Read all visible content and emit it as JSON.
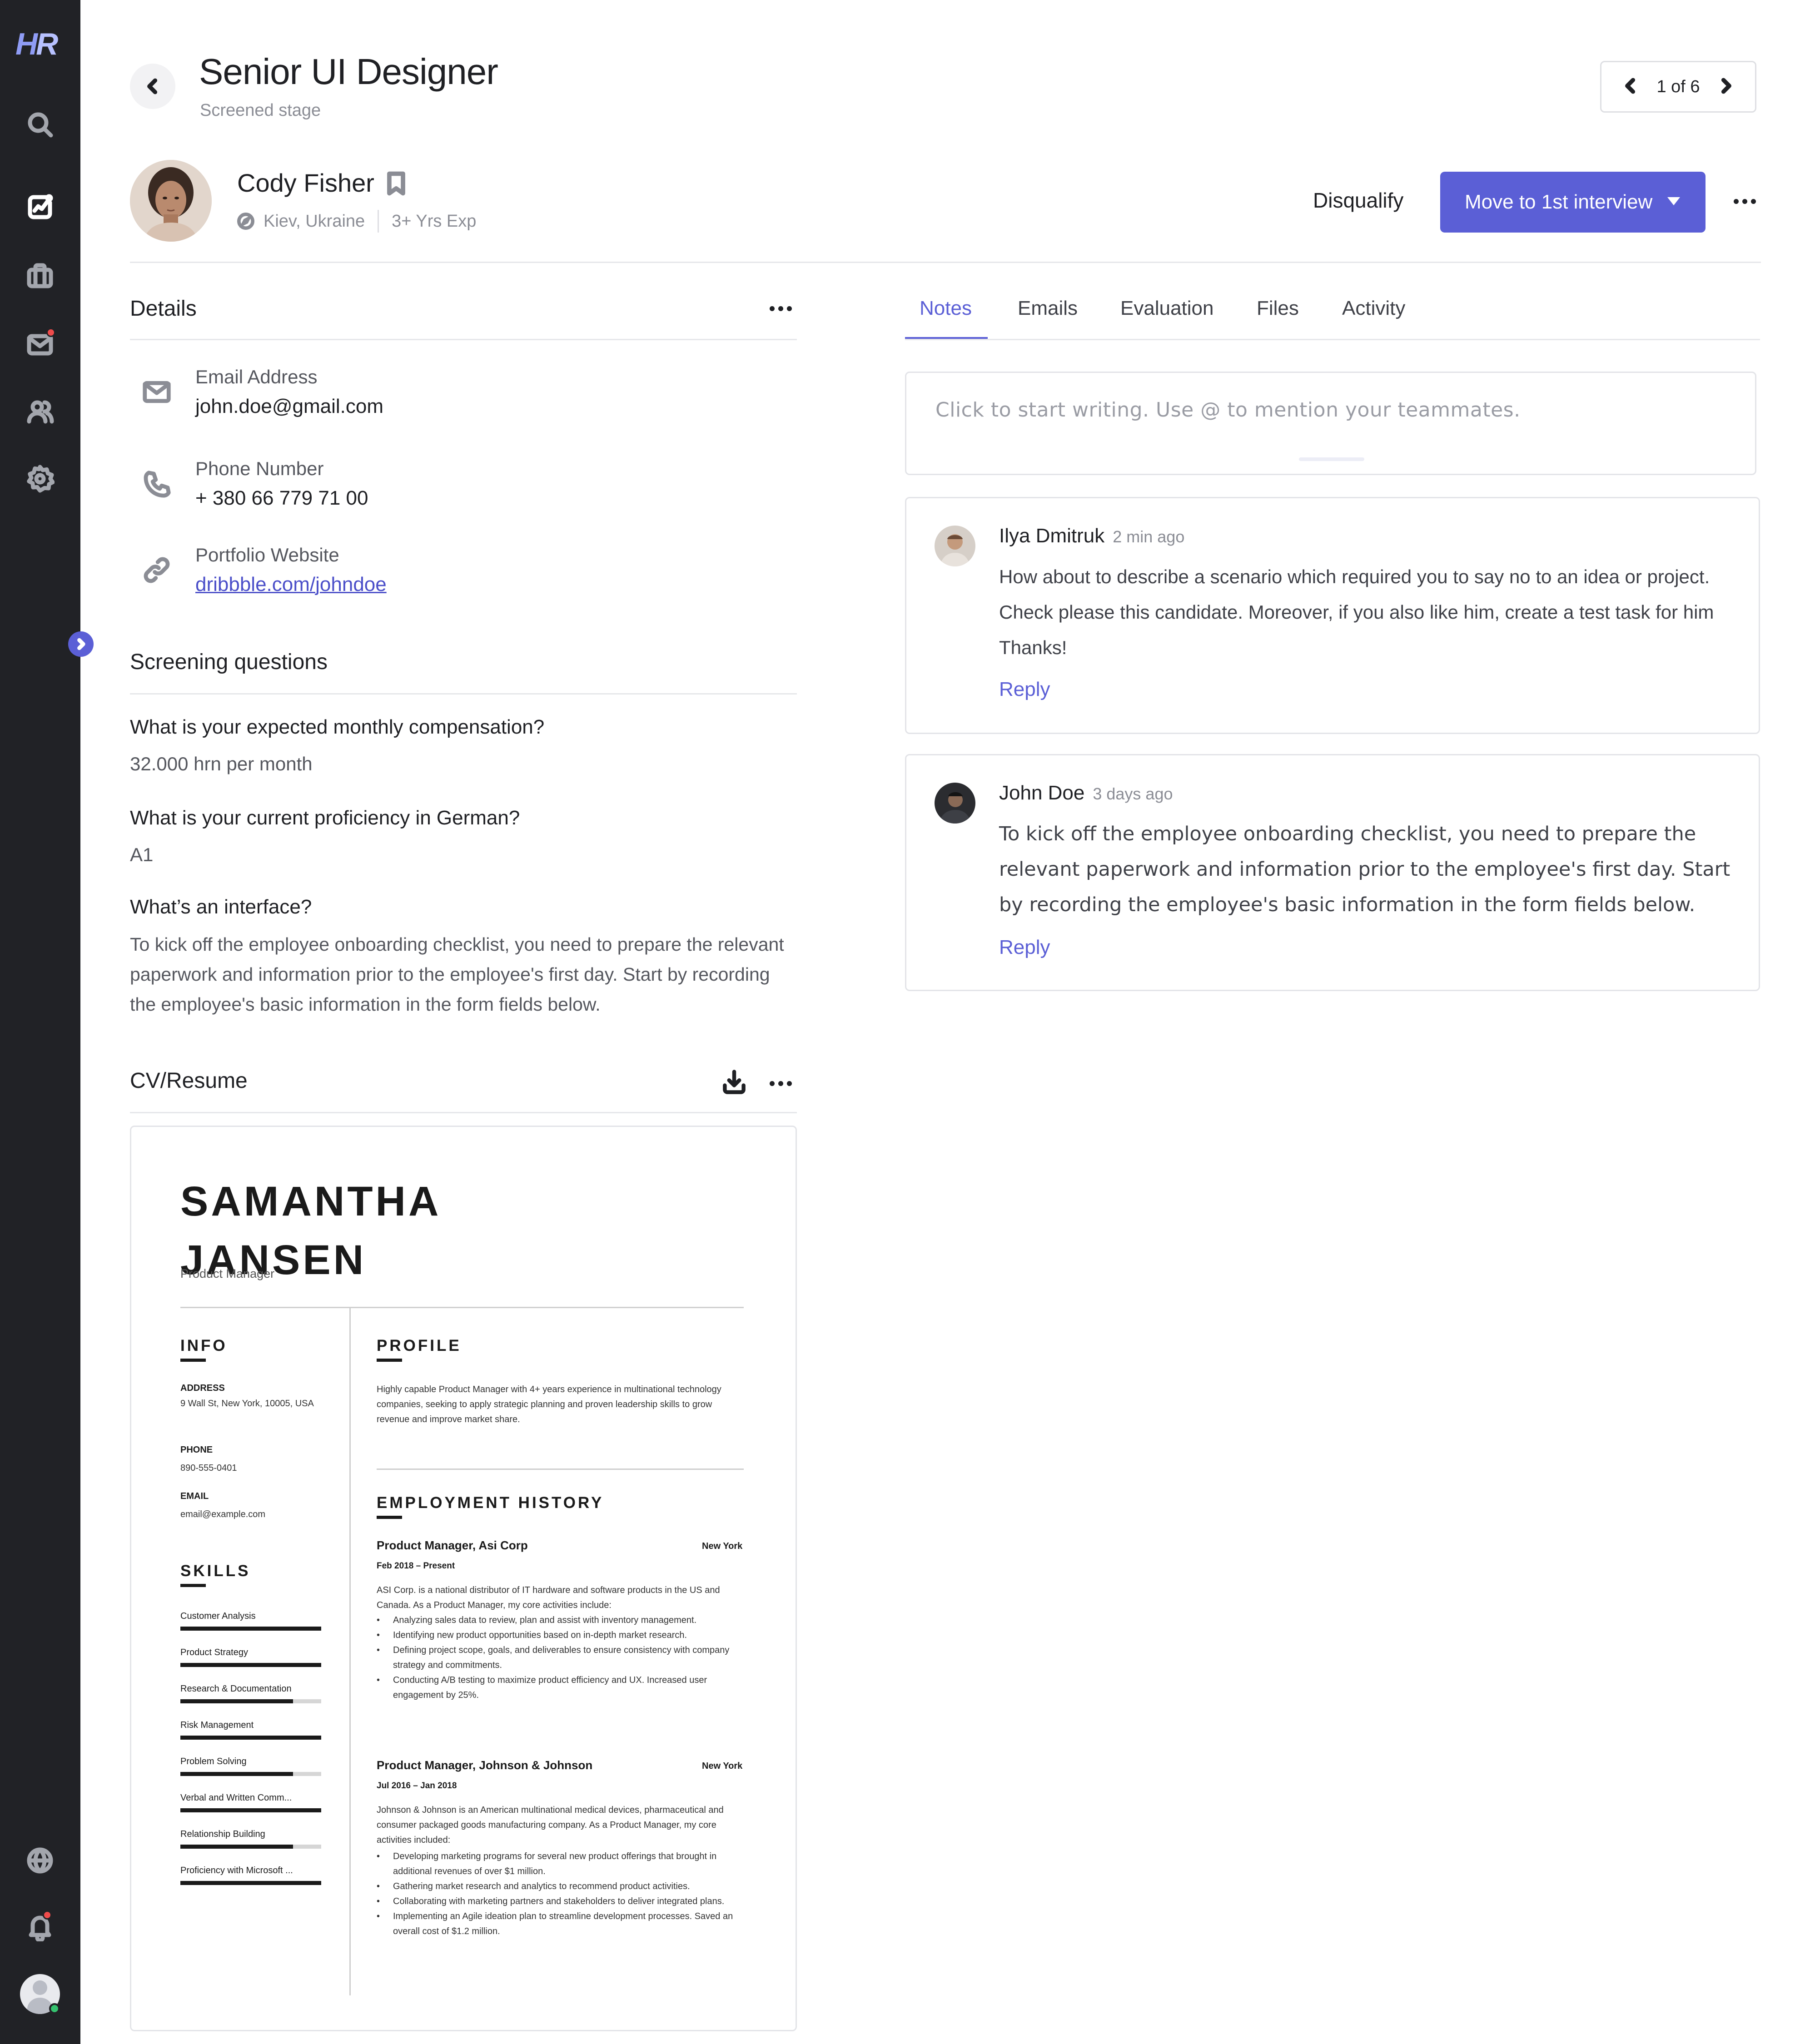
{
  "sidebar": {
    "logo_h": "H",
    "logo_r": "R",
    "nav": [
      {
        "icon": "search-icon"
      },
      {
        "icon": "analytics-icon"
      },
      {
        "icon": "briefcase-icon"
      },
      {
        "icon": "mail-icon"
      },
      {
        "icon": "users-icon"
      },
      {
        "icon": "gear-icon"
      },
      {
        "icon": "globe-icon"
      },
      {
        "icon": "bell-icon"
      }
    ]
  },
  "header": {
    "title": "Senior UI Designer",
    "stage": "Screened stage",
    "pager": "1 of 6"
  },
  "candidate": {
    "name": "Cody Fisher",
    "location": "Kiev, Ukraine",
    "experience": "3+ Yrs Exp",
    "disqualify_label": "Disqualify",
    "move_label": "Move to 1st interview"
  },
  "details": {
    "title": "Details",
    "email_label": "Email Address",
    "email_value": "john.doe@gmail.com",
    "phone_label": "Phone Number",
    "phone_value": "+ 380 66 779 71 00",
    "portfolio_label": "Portfolio Website",
    "portfolio_value": "dribbble.com/johndoe"
  },
  "screening": {
    "title": "Screening questions",
    "q1": "What is your expected monthly compensation?",
    "a1": "32.000 hrn per month",
    "q2": "What is your current proficiency in German?",
    "a2": "A1",
    "q3": "What’s an interface?",
    "a3": "To kick off the employee onboarding checklist, you need to prepare the relevant paperwork and information prior to the employee's first day. Start by recording the employee's basic information in the form fields below."
  },
  "cv": {
    "title": "CV/Resume",
    "name_line1": "SAMANTHA",
    "name_line2": "JANSEN",
    "role": "Product Manager",
    "info_heading": "INFO",
    "address_label": "ADDRESS",
    "address_value": "9 Wall St, New York, 10005, USA",
    "phone_label": "PHONE",
    "phone_value": "890-555-0401",
    "email_label": "EMAIL",
    "email_value": "email@example.com",
    "skills_heading": "SKILLS",
    "skills": [
      {
        "name": "Customer Analysis",
        "level": 1.0
      },
      {
        "name": "Product Strategy",
        "level": 1.0
      },
      {
        "name": "Research & Documentation",
        "level": 0.8
      },
      {
        "name": "Risk Management",
        "level": 1.0
      },
      {
        "name": "Problem Solving",
        "level": 0.8
      },
      {
        "name": "Verbal and Written Comm...",
        "level": 1.0
      },
      {
        "name": "Relationship Building",
        "level": 0.8
      },
      {
        "name": "Proficiency with Microsoft ...",
        "level": 1.0
      }
    ],
    "profile_heading": "PROFILE",
    "profile_text": "Highly capable Product Manager with 4+ years experience in multinational technology companies, seeking to apply strategic planning and proven leadership skills to grow revenue and improve market share.",
    "employment_heading": "EMPLOYMENT HISTORY",
    "job1": {
      "title": "Product Manager, Asi Corp",
      "location": "New York",
      "dates": "Feb 2018 – Present",
      "summary": "ASI Corp. is a national distributor of IT hardware and software products in the US and Canada. As a Product Manager, my core activities include:",
      "bullets": [
        "Analyzing sales data to review, plan and assist with inventory management.",
        "Identifying new product opportunities based on in-depth market research.",
        "Defining project scope, goals, and deliverables to ensure consistency with company strategy and commitments.",
        "Conducting A/B testing to maximize product efficiency and UX. Increased user engagement by 25%."
      ]
    },
    "job2": {
      "title": "Product Manager, Johnson & Johnson",
      "location": "New York",
      "dates": "Jul 2016 – Jan 2018",
      "summary": "Johnson & Johnson is an American multinational medical devices, pharmaceutical and consumer packaged goods manufacturing company. As a Product Manager, my core activities included:",
      "bullets": [
        "Developing marketing programs for several new product offerings that brought in additional revenues of over $1 million.",
        "Gathering market research and analytics to recommend product activities.",
        "Collaborating with marketing partners and stakeholders to deliver integrated plans.",
        "Implementing an Agile ideation plan to streamline development processes. Saved an overall cost of $1.2 million."
      ]
    }
  },
  "tabs": [
    "Notes",
    "Emails",
    "Evaluation",
    "Files",
    "Activity"
  ],
  "notes": {
    "placeholder": "Click to start writing. Use @ to mention your teammates.",
    "comments": [
      {
        "author": "Ilya Dmitruk",
        "time": "2 min ago",
        "lines": [
          "How about to describe a scenario which required you to say no to an idea or project.",
          "Check please this candidate. Moreover, if you also like him, create a test task for him",
          "Thanks!"
        ],
        "reply": "Reply"
      },
      {
        "author": "John Doe",
        "time": "3 days ago",
        "lines": [
          "To kick off the employee onboarding checklist, you need to prepare the",
          "relevant paperwork and information prior to the employee's first day. Start",
          "by recording the employee's basic information in the form fields below."
        ],
        "reply": "Reply"
      }
    ]
  },
  "colors": {
    "sidebar_bg": "#212226",
    "accent": "#5b5fd6",
    "notification_dot": "#ef4b4b",
    "online_dot": "#35c26f"
  }
}
